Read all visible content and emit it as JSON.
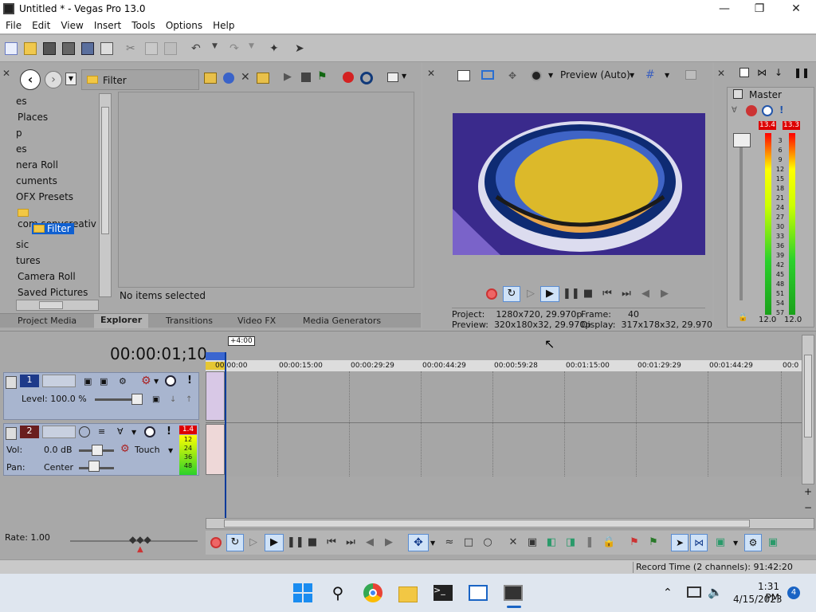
{
  "window": {
    "title": "Untitled * - Vegas Pro 13.0"
  },
  "menu": [
    "File",
    "Edit",
    "View",
    "Insert",
    "Tools",
    "Options",
    "Help"
  ],
  "explorer": {
    "path": "Filter",
    "tree": [
      "es",
      "Places",
      "p",
      "es",
      "nera Roll",
      "cuments",
      "OFX Presets",
      "com.sonycreativ",
      "Filter",
      "sic",
      "tures",
      "Camera Roll",
      "Saved Pictures"
    ],
    "status": "No items selected",
    "tabs": [
      "Project Media",
      "Explorer",
      "Transitions",
      "Video FX",
      "Media Generators"
    ]
  },
  "preview": {
    "mode": "Preview (Auto)",
    "project_label": "Project:",
    "project_value": "1280x720, 29.970p",
    "preview_label": "Preview:",
    "preview_value": "320x180x32, 29.970p",
    "frame_label": "Frame:",
    "frame_value": "40",
    "display_label": "Display:",
    "display_value": "317x178x32, 29.970"
  },
  "master": {
    "label": "Master",
    "peak_l": "13.4",
    "peak_r": "13.3",
    "bottom_l": "12.0",
    "bottom_r": "12.0",
    "scale": [
      "3",
      "6",
      "9",
      "12",
      "15",
      "18",
      "21",
      "24",
      "27",
      "30",
      "33",
      "36",
      "39",
      "42",
      "45",
      "48",
      "51",
      "54",
      "57"
    ]
  },
  "timeline": {
    "timecode": "00:00:01;10",
    "offset": "+4:00",
    "ruler": [
      "00:00:00",
      "00:00:15:00",
      "00:00:29:29",
      "00:00:44:29",
      "00:00:59:28",
      "00:01:15:00",
      "00:01:29:29",
      "00:01:44:29",
      "00:0"
    ],
    "track1": {
      "num": "1",
      "level": "Level: 100.0 %"
    },
    "track2": {
      "num": "2",
      "peak": "1.4",
      "vol_label": "Vol:",
      "vol_value": "0.0 dB",
      "mode": "Touch",
      "pan_label": "Pan:",
      "pan_value": "Center",
      "meter": [
        "12",
        "24",
        "36",
        "48"
      ]
    },
    "rate": "Rate: 1.00"
  },
  "status": {
    "record_time": "Record Time (2 channels): 91:42:20"
  },
  "taskbar": {
    "time": "1:31 PM",
    "date": "4/15/2023",
    "badge": "4"
  }
}
